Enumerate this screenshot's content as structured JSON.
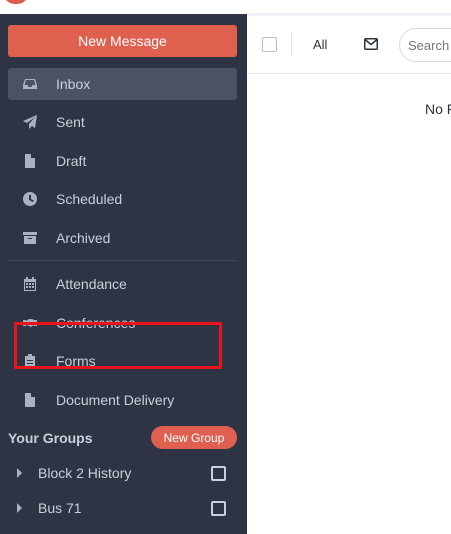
{
  "sidebar": {
    "new_message_label": "New Message",
    "nav_items": [
      {
        "label": "Inbox",
        "icon": "inbox-icon",
        "active": true
      },
      {
        "label": "Sent",
        "icon": "paper-plane-icon"
      },
      {
        "label": "Draft",
        "icon": "file-icon"
      },
      {
        "label": "Scheduled",
        "icon": "clock-icon"
      },
      {
        "label": "Archived",
        "icon": "archive-icon"
      },
      {
        "label": "Attendance",
        "icon": "calendar-icon"
      },
      {
        "label": "Conferences",
        "icon": "handshake-icon"
      },
      {
        "label": "Forms",
        "icon": "clipboard-icon"
      },
      {
        "label": "Document Delivery",
        "icon": "document-icon"
      }
    ],
    "groups_title": "Your Groups",
    "new_group_label": "New Group",
    "groups": [
      {
        "label": "Block 2 History"
      },
      {
        "label": "Bus 71"
      }
    ]
  },
  "toolbar": {
    "filter_label": "All",
    "search_placeholder": "Search"
  },
  "main": {
    "empty_text": "No F"
  },
  "colors": {
    "sidebar_bg": "#2e3443",
    "accent": "#e0604f",
    "highlight": "#e8141b"
  }
}
